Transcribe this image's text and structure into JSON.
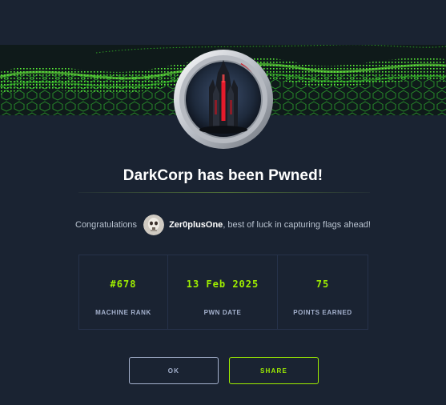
{
  "title": "DarkCorp has been Pwned!",
  "congrats": {
    "prefix": "Congratulations",
    "username": "Zer0plusOne",
    "suffix": ", best of luck in capturing flags ahead!"
  },
  "stats": [
    {
      "value": "#678",
      "label": "MACHINE RANK"
    },
    {
      "value": "13 Feb 2025",
      "label": "PWN DATE"
    },
    {
      "value": "75",
      "label": "POINTS EARNED"
    }
  ],
  "buttons": {
    "ok_label": "OK",
    "share_label": "SHARE"
  },
  "colors": {
    "background": "#1a2332",
    "accent": "#9fef00",
    "muted": "#a4b1cd",
    "border": "#26324a"
  },
  "icons": {
    "machine": "darkcorp-machine-logo",
    "user": "user-avatar-skull"
  }
}
